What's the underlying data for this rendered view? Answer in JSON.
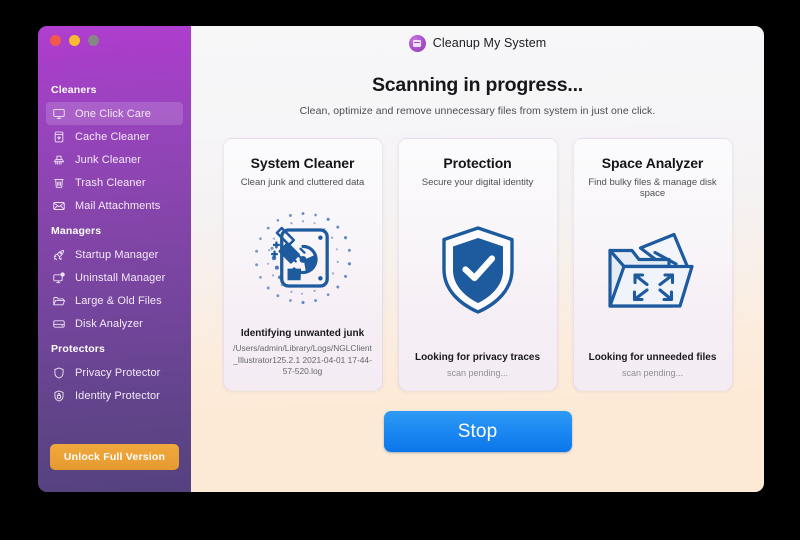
{
  "window": {
    "traffic_lights": [
      "close",
      "minimize",
      "zoom"
    ],
    "app_title": "Cleanup My System"
  },
  "sidebar": {
    "groups": [
      {
        "title": "Cleaners",
        "items": [
          {
            "label": "One Click Care",
            "icon": "monitor-icon",
            "active": true
          },
          {
            "label": "Cache Cleaner",
            "icon": "cache-icon",
            "active": false
          },
          {
            "label": "Junk Cleaner",
            "icon": "broom-icon",
            "active": false
          },
          {
            "label": "Trash Cleaner",
            "icon": "trash-icon",
            "active": false
          },
          {
            "label": "Mail Attachments",
            "icon": "envelope-icon",
            "active": false
          }
        ]
      },
      {
        "title": "Managers",
        "items": [
          {
            "label": "Startup Manager",
            "icon": "rocket-icon",
            "active": false
          },
          {
            "label": "Uninstall Manager",
            "icon": "uninstall-icon",
            "active": false
          },
          {
            "label": "Large & Old Files",
            "icon": "folder-icon",
            "active": false
          },
          {
            "label": "Disk Analyzer",
            "icon": "disk-icon",
            "active": false
          }
        ]
      },
      {
        "title": "Protectors",
        "items": [
          {
            "label": "Privacy Protector",
            "icon": "shield-icon",
            "active": false
          },
          {
            "label": "Identity Protector",
            "icon": "lock-icon",
            "active": false
          }
        ]
      }
    ],
    "unlock_button": "Unlock Full Version"
  },
  "main": {
    "headline": "Scanning in progress...",
    "subline": "Clean, optimize and remove unnecessary files from system in just one click.",
    "cards": [
      {
        "title": "System Cleaner",
        "subtitle": "Clean junk and cluttered data",
        "art": "broom-disk-icon",
        "status": "Identifying unwanted junk",
        "detail": "/Users/admin/Library/Logs/NGLClient_Illustrator125.2.1 2021-04-01 17-44-57-520.log",
        "pending": ""
      },
      {
        "title": "Protection",
        "subtitle": "Secure your digital identity",
        "art": "shield-check-icon",
        "status": "Looking for privacy traces",
        "detail": "",
        "pending": "scan pending..."
      },
      {
        "title": "Space Analyzer",
        "subtitle": "Find bulky files & manage disk space",
        "art": "folder-expand-icon",
        "status": "Looking for unneeded files",
        "detail": "",
        "pending": "scan pending..."
      }
    ],
    "stop_button": "Stop"
  },
  "colors": {
    "sidebar_top": "#b13fd0",
    "sidebar_bottom": "#554180",
    "accent_blue": "#1d89f2",
    "unlock_orange": "#e59a30",
    "icon_blue": "#1d5a9e"
  }
}
